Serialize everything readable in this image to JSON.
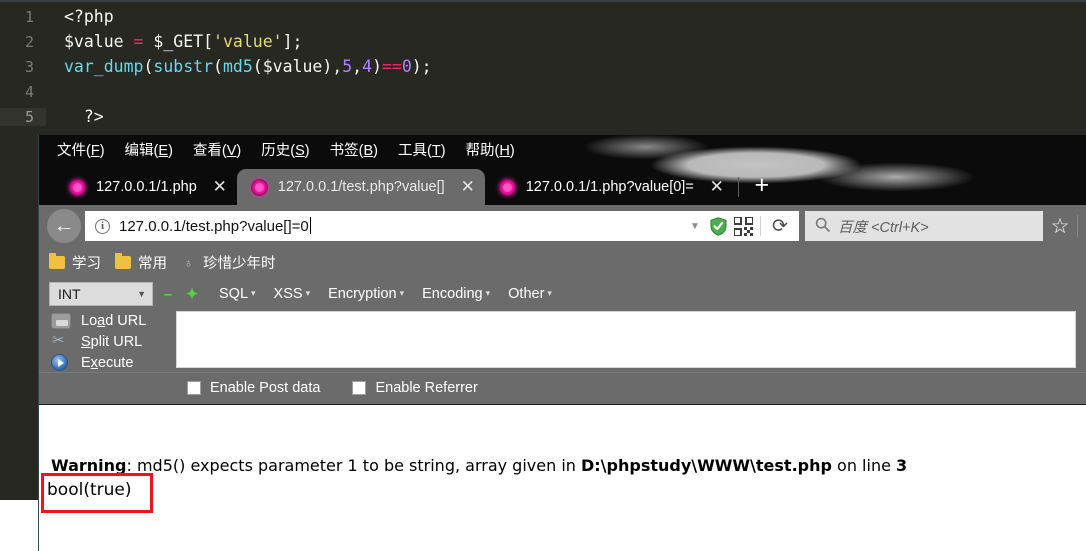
{
  "editor": {
    "lines": [
      {
        "num": "1",
        "current": false,
        "tokens": [
          {
            "t": "<?php",
            "c": "tok-plain"
          }
        ]
      },
      {
        "num": "2",
        "current": false,
        "tokens": [
          {
            "t": "$value ",
            "c": "tok-var"
          },
          {
            "t": "=",
            "c": "tok-op"
          },
          {
            "t": " $_GET[",
            "c": "tok-plain"
          },
          {
            "t": "'value'",
            "c": "tok-str"
          },
          {
            "t": "];",
            "c": "tok-plain"
          }
        ]
      },
      {
        "num": "3",
        "current": false,
        "tokens": [
          {
            "t": "var_dump",
            "c": "tok-func"
          },
          {
            "t": "(",
            "c": "tok-punct"
          },
          {
            "t": "substr",
            "c": "tok-func"
          },
          {
            "t": "(",
            "c": "tok-punct"
          },
          {
            "t": "md5",
            "c": "tok-func"
          },
          {
            "t": "($value),",
            "c": "tok-punct"
          },
          {
            "t": "5",
            "c": "tok-num"
          },
          {
            "t": ",",
            "c": "tok-punct"
          },
          {
            "t": "4",
            "c": "tok-num"
          },
          {
            "t": ")",
            "c": "tok-punct"
          },
          {
            "t": "==",
            "c": "tok-op"
          },
          {
            "t": "0",
            "c": "tok-num"
          },
          {
            "t": ");",
            "c": "tok-punct"
          }
        ]
      },
      {
        "num": "4",
        "current": false,
        "tokens": [
          {
            "t": "",
            "c": "tok-plain"
          }
        ]
      },
      {
        "num": "5",
        "current": true,
        "tokens": [
          {
            "t": "  ?>",
            "c": "tok-plain"
          }
        ]
      }
    ]
  },
  "browser": {
    "menubar": [
      {
        "label": "文件(",
        "accel": "F",
        "tail": ")"
      },
      {
        "label": "编辑(",
        "accel": "E",
        "tail": ")"
      },
      {
        "label": "查看(",
        "accel": "V",
        "tail": ")"
      },
      {
        "label": "历史(",
        "accel": "S",
        "tail": ")"
      },
      {
        "label": "书签(",
        "accel": "B",
        "tail": ")"
      },
      {
        "label": "工具(",
        "accel": "T",
        "tail": ")"
      },
      {
        "label": "帮助(",
        "accel": "H",
        "tail": ")"
      }
    ],
    "tabs": [
      {
        "title": "127.0.0.1/1.php",
        "active": false,
        "close": "✕"
      },
      {
        "title": "127.0.0.1/test.php?value[]",
        "active": true,
        "close": "✕"
      },
      {
        "title": "127.0.0.1/1.php?value[0]=",
        "active": false,
        "close": "✕"
      }
    ],
    "newtab_label": "+",
    "nav": {
      "back_glyph": "←",
      "info_glyph": "i",
      "url": "127.0.0.1/test.php?value[]=0",
      "dropdown_glyph": "▼",
      "shield_icon": "shield-check-icon",
      "qr_icon": "qr-code-icon",
      "reload_glyph": "⟳",
      "star_glyph": "☆"
    },
    "search": {
      "icon_glyph": "⚲",
      "placeholder": "百度 <Ctrl+K>"
    },
    "bookmarks": [
      {
        "label": "学习",
        "type": "folder"
      },
      {
        "label": "常用",
        "type": "folder"
      },
      {
        "label": "珍惜少年时",
        "type": "site",
        "glyph": "♁"
      }
    ]
  },
  "hackbar": {
    "type_select": {
      "value": "INT",
      "chevron": "▼"
    },
    "decrement": "–",
    "increment": "✦",
    "menus": [
      {
        "label": "SQL",
        "caret": "▾"
      },
      {
        "label": "XSS",
        "caret": "▾"
      },
      {
        "label": "Encryption",
        "caret": "▾"
      },
      {
        "label": "Encoding",
        "caret": "▾"
      },
      {
        "label": "Other",
        "caret": "▾"
      }
    ],
    "actions": [
      {
        "pre": "Lo",
        "accel": "a",
        "post": "d URL",
        "icon": "load-url-icon"
      },
      {
        "pre": "",
        "accel": "S",
        "post": "plit URL",
        "icon": "split-url-icon"
      },
      {
        "pre": "E",
        "accel": "x",
        "post": "ecute",
        "icon": "execute-icon"
      }
    ],
    "textarea_value": "",
    "checkboxes": [
      {
        "label": "Enable Post data",
        "checked": false
      },
      {
        "label": "Enable Referrer",
        "checked": false
      }
    ]
  },
  "page": {
    "warning_label": "Warning",
    "warning_sep": ": ",
    "warning_msg_1": "md5() expects parameter 1 to be string, array given in ",
    "warning_path": "D:\\phpstudy\\WWW\\test.php",
    "warning_msg_2": " on line ",
    "warning_line_no": "3",
    "result": "bool(true)"
  },
  "colors": {
    "editor_bg": "#272822",
    "chrome_bg": "#6b6b6b",
    "tabstrip_bg": "#0b0b0b",
    "favicon": "#e8129c",
    "highlight_border": "#f01616",
    "accent_green": "#5bd14a"
  }
}
